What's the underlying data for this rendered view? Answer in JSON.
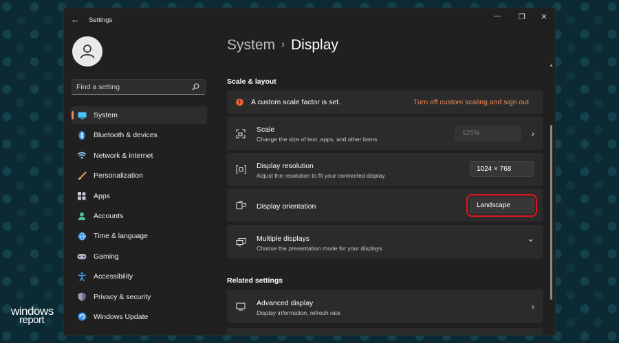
{
  "window": {
    "title": "Settings",
    "back_glyph": "←",
    "minimize_glyph": "—",
    "maximize_glyph": "❐",
    "close_glyph": "✕"
  },
  "search": {
    "placeholder": "Find a setting",
    "value": ""
  },
  "sidebar": {
    "items": [
      {
        "label": "System",
        "icon": "monitor-icon",
        "active": true
      },
      {
        "label": "Bluetooth & devices",
        "icon": "bluetooth-icon"
      },
      {
        "label": "Network & internet",
        "icon": "wifi-icon"
      },
      {
        "label": "Personalization",
        "icon": "brush-icon"
      },
      {
        "label": "Apps",
        "icon": "apps-icon"
      },
      {
        "label": "Accounts",
        "icon": "person-icon"
      },
      {
        "label": "Time & language",
        "icon": "globe-clock-icon"
      },
      {
        "label": "Gaming",
        "icon": "gamepad-icon"
      },
      {
        "label": "Accessibility",
        "icon": "accessibility-icon"
      },
      {
        "label": "Privacy & security",
        "icon": "shield-icon"
      },
      {
        "label": "Windows Update",
        "icon": "update-icon"
      }
    ]
  },
  "breadcrumb": {
    "parent": "System",
    "separator": "›",
    "current": "Display"
  },
  "scale_layout": {
    "heading": "Scale & layout",
    "notice": {
      "text": "A custom scale factor is set.",
      "link": "Turn off custom scaling and sign out"
    },
    "scale": {
      "title": "Scale",
      "subtitle": "Change the size of text, apps, and other items",
      "value": "125%",
      "arrow": "›"
    },
    "resolution": {
      "title": "Display resolution",
      "subtitle": "Adjust the resolution to fit your connected display",
      "value": "1024 × 768"
    },
    "orientation": {
      "title": "Display orientation",
      "value": "Landscape"
    },
    "multiple": {
      "title": "Multiple displays",
      "subtitle": "Choose the presentation mode for your displays",
      "chevron": "⌄"
    }
  },
  "related": {
    "heading": "Related settings",
    "advanced": {
      "title": "Advanced display",
      "subtitle": "Display information, refresh rate",
      "arrow": "›"
    }
  },
  "dropdown_chevron": "⌄",
  "watermark": {
    "line1": "windows",
    "line2": "report"
  },
  "colors": {
    "accent": "#f08a5d",
    "warning": "#e8643c",
    "highlight": "#e0141f",
    "window_bg": "#202020",
    "card_bg": "#2b2b2b"
  }
}
